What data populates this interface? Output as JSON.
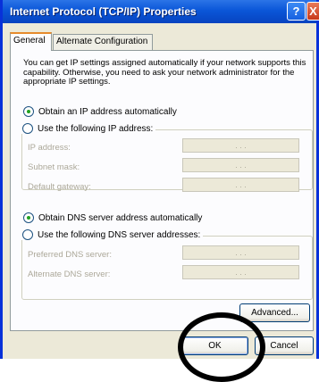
{
  "window": {
    "title": "Internet Protocol (TCP/IP) Properties"
  },
  "titlebar": {
    "help_glyph": "?",
    "close_glyph": "X"
  },
  "tabs": [
    {
      "label": "General"
    },
    {
      "label": "Alternate Configuration"
    }
  ],
  "info_text": "You can get IP settings assigned automatically if your network supports this capability. Otherwise, you need to ask your network administrator for the appropriate IP settings.",
  "ip": {
    "auto_label": "Obtain an IP address automatically",
    "manual_label": "Use the following IP address:",
    "fields": [
      {
        "label": "IP address:",
        "value": ". . ."
      },
      {
        "label": "Subnet mask:",
        "value": ". . ."
      },
      {
        "label": "Default gateway:",
        "value": ". . ."
      }
    ]
  },
  "dns": {
    "auto_label": "Obtain DNS server address automatically",
    "manual_label": "Use the following DNS server addresses:",
    "fields": [
      {
        "label": "Preferred DNS server:",
        "value": ". . ."
      },
      {
        "label": "Alternate DNS server:",
        "value": ". . ."
      }
    ]
  },
  "buttons": {
    "advanced": "Advanced...",
    "ok": "OK",
    "cancel": "Cancel"
  },
  "colors": {
    "title_blue": "#0a56d8",
    "dialog_bg": "#ece9d8",
    "radio_dot": "#21a121",
    "annotation_circle": "#000000"
  }
}
